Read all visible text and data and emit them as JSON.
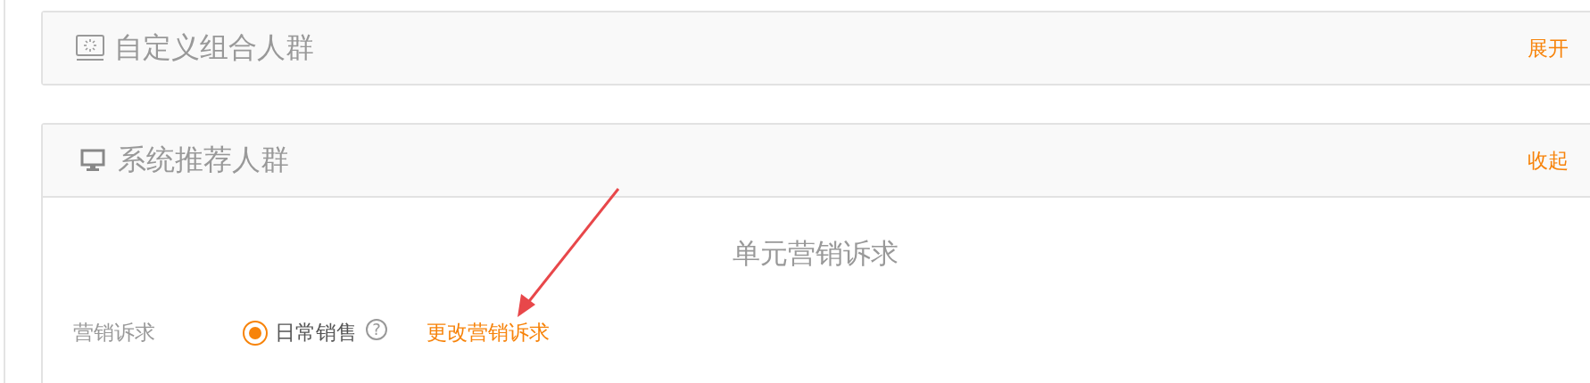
{
  "panels": [
    {
      "title": "自定义组合人群",
      "toggle": "展开",
      "expanded": false
    },
    {
      "title": "系统推荐人群",
      "toggle": "收起",
      "expanded": true,
      "body": {
        "section_title": "单元营销诉求",
        "field": {
          "label": "营销诉求",
          "options": [
            {
              "label": "日常销售",
              "selected": true
            }
          ],
          "help": "?",
          "link": "更改营销诉求"
        }
      }
    }
  ]
}
